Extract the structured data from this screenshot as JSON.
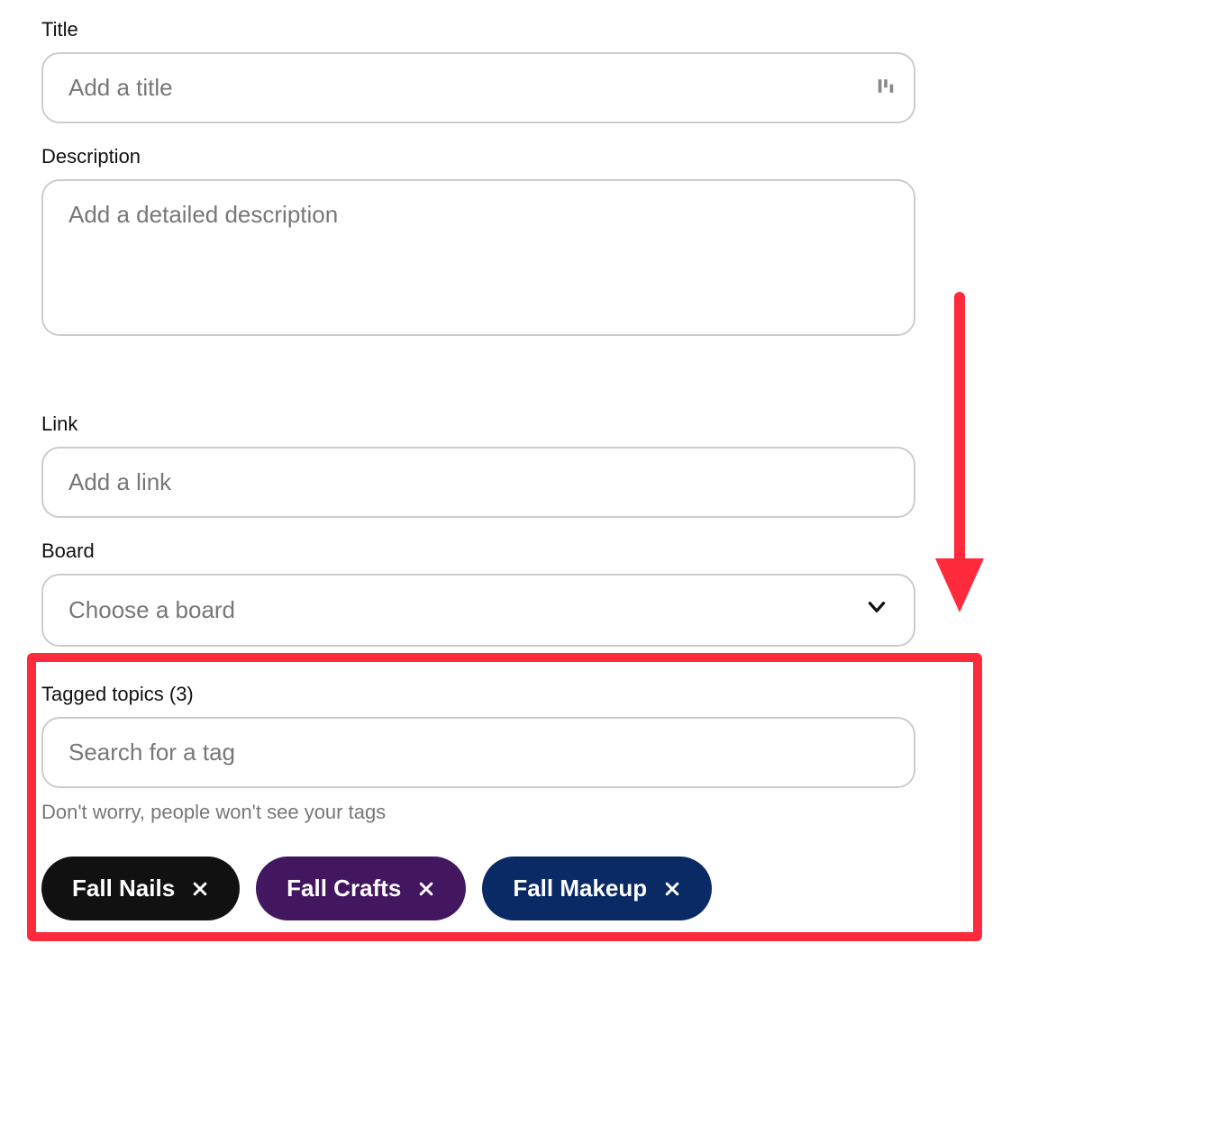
{
  "title": {
    "label": "Title",
    "placeholder": "Add a title",
    "value": ""
  },
  "description": {
    "label": "Description",
    "placeholder": "Add a detailed description",
    "value": ""
  },
  "link": {
    "label": "Link",
    "placeholder": "Add a link",
    "value": ""
  },
  "board": {
    "label": "Board",
    "placeholder": "Choose a board"
  },
  "tags": {
    "label": "Tagged topics (3)",
    "placeholder": "Search for a tag",
    "help": "Don't worry, people won't see your tags",
    "items": [
      {
        "label": "Fall Nails",
        "color": "#111111"
      },
      {
        "label": "Fall Crafts",
        "color": "#421760"
      },
      {
        "label": "Fall Makeup",
        "color": "#0a2a66"
      }
    ]
  }
}
